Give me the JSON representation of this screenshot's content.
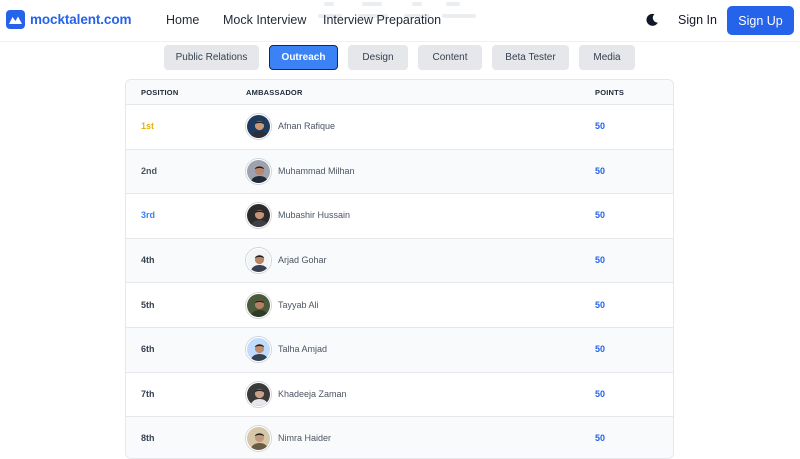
{
  "header": {
    "logo_text": "mocktalent.com",
    "nav": [
      "Home",
      "Mock Interview",
      "Interview Preparation"
    ],
    "theme_icon": "moon-icon",
    "sign_in": "Sign In",
    "sign_up": "Sign Up"
  },
  "tabs": [
    {
      "label": "Public Relations",
      "active": false
    },
    {
      "label": "Outreach",
      "active": true
    },
    {
      "label": "Design",
      "active": false
    },
    {
      "label": "Content",
      "active": false
    },
    {
      "label": "Beta Tester",
      "active": false
    },
    {
      "label": "Media",
      "active": false
    }
  ],
  "table": {
    "headers": [
      "POSITION",
      "AMBASSADOR",
      "POINTS"
    ],
    "rows": [
      {
        "position": "1st",
        "name": "Afnan Rafique",
        "points": "50",
        "pos_color": "#eab308"
      },
      {
        "position": "2nd",
        "name": "Muhammad Milhan",
        "points": "50",
        "pos_color": "#4b5563"
      },
      {
        "position": "3rd",
        "name": "Mubashir Hussain",
        "points": "50",
        "pos_color": "#3b82f6"
      },
      {
        "position": "4th",
        "name": "Arjad Gohar",
        "points": "50",
        "pos_color": "#374151"
      },
      {
        "position": "5th",
        "name": "Tayyab Ali",
        "points": "50",
        "pos_color": "#374151"
      },
      {
        "position": "6th",
        "name": "Talha Amjad",
        "points": "50",
        "pos_color": "#374151"
      },
      {
        "position": "7th",
        "name": "Khadeeja Zaman",
        "points": "50",
        "pos_color": "#374151"
      },
      {
        "position": "8th",
        "name": "Nimra Haider",
        "points": "50",
        "pos_color": "#374151"
      }
    ]
  },
  "colors": {
    "brand": "#2563eb",
    "active_tab": "#3b82f6",
    "gold": "#eab308",
    "points": "#2563eb"
  }
}
